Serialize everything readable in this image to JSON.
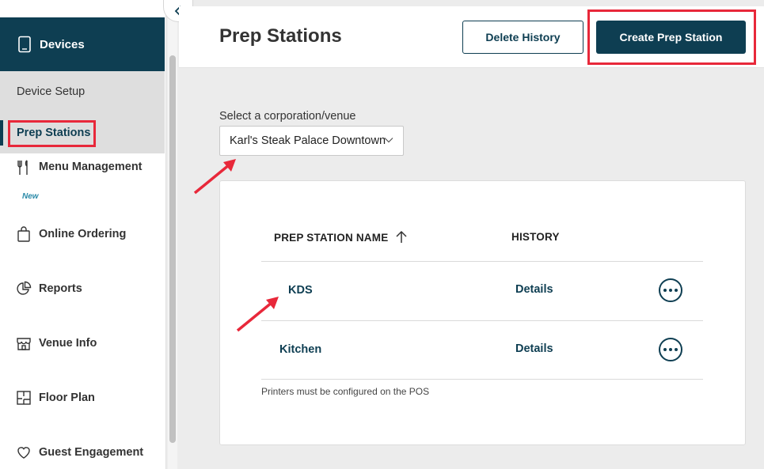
{
  "sidebar": {
    "devices_label": "Devices",
    "sub_items": [
      {
        "label": "Device Setup"
      },
      {
        "label": "Prep Stations"
      }
    ],
    "items": [
      {
        "label": "Menu Management",
        "badge": "New"
      },
      {
        "label": "Online Ordering"
      },
      {
        "label": "Reports"
      },
      {
        "label": "Venue Info"
      },
      {
        "label": "Floor Plan"
      },
      {
        "label": "Guest Engagement"
      }
    ]
  },
  "header": {
    "title": "Prep Stations",
    "delete_label": "Delete History",
    "create_label": "Create Prep Station"
  },
  "venue": {
    "label": "Select a corporation/venue",
    "selected": "Karl's Steak Palace Downtown"
  },
  "table": {
    "columns": [
      "PREP STATION NAME",
      "HISTORY"
    ],
    "rows": [
      {
        "name": "KDS",
        "history": "Details"
      },
      {
        "name": "Kitchen",
        "history": "Details"
      }
    ],
    "footnote": "Printers must be configured on the POS"
  },
  "colors": {
    "primary": "#0e3e52",
    "highlight": "#e8283a",
    "accent_badge": "#2a8aa8"
  }
}
